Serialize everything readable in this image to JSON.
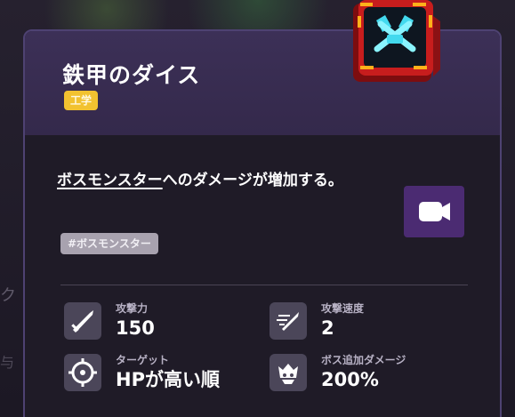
{
  "item": {
    "title": "鉄甲のダイス",
    "category": "工学",
    "description_highlight": "ボスモンスター",
    "description_rest": "へのダメージが増加する。",
    "keyword": "#ボスモンスター",
    "icon": "dice-crossed-hammers-icon",
    "video_icon": "video-camera-icon"
  },
  "stats": [
    {
      "label": "攻撃力",
      "value": "150",
      "icon": "sword-icon"
    },
    {
      "label": "攻撃速度",
      "value": "2",
      "icon": "speed-sword-icon"
    },
    {
      "label": "ターゲット",
      "value": "HPが高い順",
      "icon": "target-icon"
    },
    {
      "label": "ボス追加ダメージ",
      "value": "200%",
      "icon": "boss-skull-icon"
    }
  ],
  "background": {
    "left_partial_1": "ク",
    "left_partial_2": "与"
  },
  "colors": {
    "header_purple": "#3c3057",
    "card_border": "#4e4272",
    "tag_yellow": "#f2c230",
    "video_button_purple": "#4b2b72",
    "icon_tile": "#4b4659",
    "dice_red": "#c71d1d",
    "dice_cyan": "#43d9ee"
  }
}
